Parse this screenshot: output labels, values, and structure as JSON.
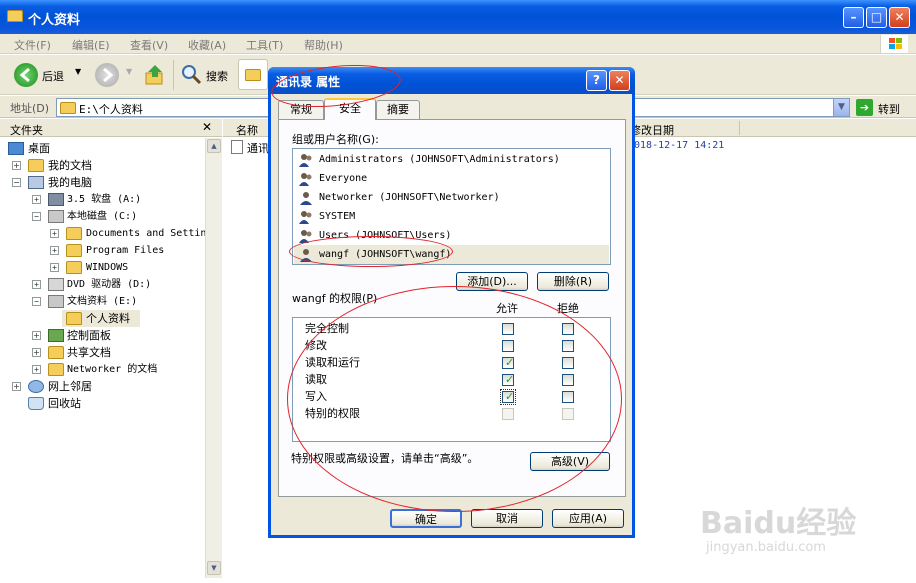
{
  "window": {
    "title": "个人资料"
  },
  "menu": [
    "文件(F)",
    "编辑(E)",
    "查看(V)",
    "收藏(A)",
    "工具(T)",
    "帮助(H)"
  ],
  "toolbar": {
    "back": "后退",
    "search": "搜索"
  },
  "address": {
    "label": "地址(D)",
    "path": "E:\\个人资料",
    "go": "转到"
  },
  "folders_pane": {
    "title": "文件夹",
    "close": "✕"
  },
  "tree": [
    {
      "label": "桌面",
      "icon": "desktop-icon"
    },
    {
      "label": "我的文档",
      "icon": "folder-icon"
    },
    {
      "label": "我的电脑",
      "icon": "computer-icon"
    },
    {
      "label": "3.5 软盘 (A:)",
      "icon": "floppy-icon"
    },
    {
      "label": "本地磁盘 (C:)",
      "icon": "drive-icon"
    },
    {
      "label": "Documents and Settings",
      "icon": "folder-icon"
    },
    {
      "label": "Program Files",
      "icon": "folder-icon"
    },
    {
      "label": "WINDOWS",
      "icon": "folder-icon"
    },
    {
      "label": "DVD 驱动器 (D:)",
      "icon": "dvd-icon"
    },
    {
      "label": "文档资料 (E:)",
      "icon": "drive-icon"
    },
    {
      "label": "个人资料",
      "icon": "folder-open-icon"
    },
    {
      "label": "控制面板",
      "icon": "control-panel-icon"
    },
    {
      "label": "共享文档",
      "icon": "folder-icon"
    },
    {
      "label": "Networker 的文档",
      "icon": "folder-icon"
    },
    {
      "label": "网上邻居",
      "icon": "network-icon"
    },
    {
      "label": "回收站",
      "icon": "recycle-bin-icon"
    }
  ],
  "list": {
    "columns": [
      "名称",
      "修改日期"
    ],
    "rows": [
      {
        "name": "通讯",
        "modified": "2018-12-17 14:21"
      }
    ]
  },
  "dialog": {
    "title": "通讯录 属性",
    "help": "?",
    "close": "✕",
    "tabs": [
      "常规",
      "安全",
      "摘要"
    ],
    "active_tab": "安全",
    "users_label": "组或用户名称(G):",
    "users": [
      "Administrators (JOHNSOFT\\Administrators)",
      "Everyone",
      "Networker (JOHNSOFT\\Networker)",
      "SYSTEM",
      "Users (JOHNSOFT\\Users)",
      "wangf (JOHNSOFT\\wangf)"
    ],
    "selected_user": "wangf (JOHNSOFT\\wangf)",
    "add_button": "添加(D)...",
    "remove_button": "删除(R)",
    "perm_label": "wangf 的权限(P)",
    "allow_label": "允许",
    "deny_label": "拒绝",
    "permissions": [
      {
        "name": "完全控制",
        "allow": false,
        "deny": false,
        "disabled": false
      },
      {
        "name": "修改",
        "allow": false,
        "deny": false,
        "disabled": false
      },
      {
        "name": "读取和运行",
        "allow": true,
        "deny": false,
        "disabled": false
      },
      {
        "name": "读取",
        "allow": true,
        "deny": false,
        "disabled": false
      },
      {
        "name": "写入",
        "allow": true,
        "deny": false,
        "disabled": false
      },
      {
        "name": "特别的权限",
        "allow": false,
        "deny": false,
        "disabled": true
      }
    ],
    "advanced_hint": "特别权限或高级设置，请单击“高级”。",
    "advanced_button": "高级(V)",
    "ok_button": "确定",
    "cancel_button": "取消",
    "apply_button": "应用(A)"
  },
  "watermark": {
    "brand": "Baidu经验",
    "url": "jingyan.baidu.com"
  },
  "colors": {
    "titlebar": "#0052d6",
    "annotation": "#e0242b",
    "face": "#ece9d8"
  }
}
